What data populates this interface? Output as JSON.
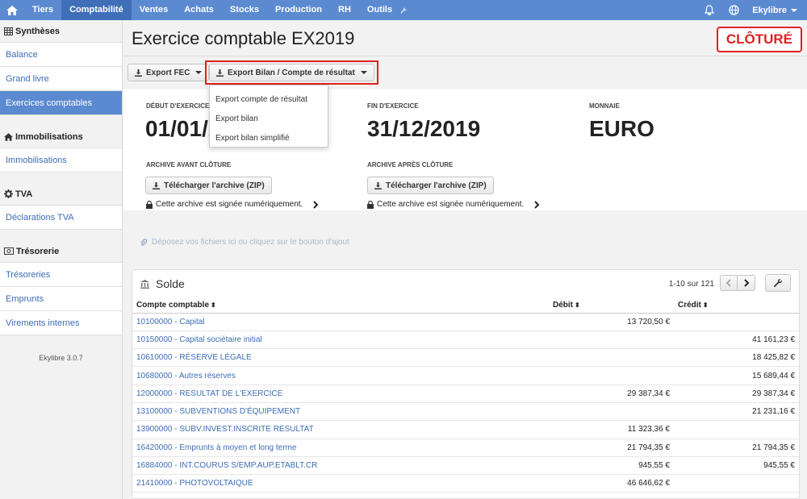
{
  "nav": {
    "items": [
      {
        "label": "Tiers",
        "active": false
      },
      {
        "label": "Comptabilité",
        "active": true
      },
      {
        "label": "Ventes",
        "active": false
      },
      {
        "label": "Achats",
        "active": false
      },
      {
        "label": "Stocks",
        "active": false
      },
      {
        "label": "Production",
        "active": false
      },
      {
        "label": "RH",
        "active": false
      },
      {
        "label": "Outils",
        "active": false
      }
    ],
    "user": "Ekylibre"
  },
  "sidebar": {
    "sections": [
      {
        "title": "Synthèses",
        "icon": "table-icon",
        "items": [
          {
            "label": "Balance",
            "active": false
          },
          {
            "label": "Grand livre",
            "active": false
          },
          {
            "label": "Exercices comptables",
            "active": true
          }
        ]
      },
      {
        "title": "Immobilisations",
        "icon": "home-icon",
        "items": [
          {
            "label": "Immobilisations",
            "active": false
          }
        ]
      },
      {
        "title": "TVA",
        "icon": "gear-icon",
        "items": [
          {
            "label": "Déclarations TVA",
            "active": false
          }
        ]
      },
      {
        "title": "Trésorerie",
        "icon": "money-icon",
        "items": [
          {
            "label": "Trésoreries",
            "active": false
          },
          {
            "label": "Emprunts",
            "active": false
          },
          {
            "label": "Virements internes",
            "active": false
          }
        ]
      }
    ],
    "version": "Ekylibre 3.0.7"
  },
  "page": {
    "title": "Exercice comptable EX2019",
    "status_badge": "CLÔTURÉ",
    "export_fec": "Export FEC",
    "export_bilan": "Export Bilan / Compte de résultat"
  },
  "dropdown": {
    "items": [
      "Export compte de résultat",
      "Export bilan",
      "Export bilan simplifié"
    ]
  },
  "info": {
    "start_label": "DÉBUT D'EXERCICE",
    "start_value": "01/01/2019",
    "end_label": "FIN D'EXERCICE",
    "end_value": "31/12/2019",
    "currency_label": "MONNAIE",
    "currency_value": "EURO",
    "archive_before_label": "ARCHIVE AVANT CLÔTURE",
    "archive_after_label": "ARCHIVE APRÈS CLÔTURE",
    "download_label": "Télécharger l'archive (ZIP)",
    "signed_text": "Cette archive est signée numériquement."
  },
  "dropzone": "Déposez vos fichiers ici ou cliquez sur le bouton d'ajout",
  "solde": {
    "title": "Solde",
    "pager_text": "1-10 sur 121",
    "columns": [
      "Compte comptable",
      "Débit",
      "Crédit"
    ],
    "rows": [
      {
        "account": "10100000 - Capital",
        "debit": "13 720,50 €",
        "credit": ""
      },
      {
        "account": "10150000 - Capital sociétaire initial",
        "debit": "",
        "credit": "41 161,23 €"
      },
      {
        "account": "10610000 - RÉSERVE LÉGALE",
        "debit": "",
        "credit": "18 425,82 €"
      },
      {
        "account": "10680000 - Autres réserves",
        "debit": "",
        "credit": "15 689,44 €"
      },
      {
        "account": "12000000 - RESULTAT DE L'EXERCICE",
        "debit": "29 387,34 €",
        "credit": "29 387,34 €"
      },
      {
        "account": "13100000 - SUBVENTIONS D'ÉQUIPEMENT",
        "debit": "",
        "credit": "21 231,16 €"
      },
      {
        "account": "13900000 - SUBV.INVEST.INSCRITE RESULTAT",
        "debit": "11 323,36 €",
        "credit": ""
      },
      {
        "account": "16420000 - Emprunts à moyen et long terme",
        "debit": "21 794,35 €",
        "credit": "21 794,35 €"
      },
      {
        "account": "16884000 - INT.COURUS S/EMP.AUP.ETABLT.CR",
        "debit": "945,55 €",
        "credit": "945,55 €"
      },
      {
        "account": "21410000 - PHOTOVOLTAIQUE",
        "debit": "46 646,62 €",
        "credit": ""
      }
    ]
  },
  "colors": {
    "nav_bg": "#5b8ad1",
    "nav_active": "#3f6fb8",
    "link": "#3d6db5",
    "highlight_red": "#e02020"
  }
}
